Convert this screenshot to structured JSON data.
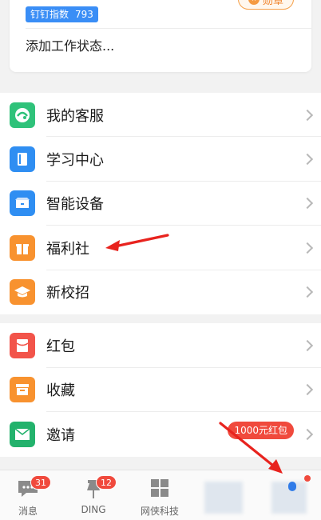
{
  "profile": {
    "index_label": "钉钉指数",
    "index_value": "793",
    "medal_label": "勋章",
    "status_placeholder": "添加工作状态..."
  },
  "menu_group_1": [
    {
      "label": "我的客服",
      "icon": "customer-service-icon",
      "color": "#2fc27a"
    },
    {
      "label": "学习中心",
      "icon": "book-icon",
      "color": "#2f8ef2"
    },
    {
      "label": "智能设备",
      "icon": "device-icon",
      "color": "#2f8ef2"
    },
    {
      "label": "福利社",
      "icon": "gift-icon",
      "color": "#f8922f"
    },
    {
      "label": "新校招",
      "icon": "graduation-cap-icon",
      "color": "#f8922f"
    }
  ],
  "menu_group_2": [
    {
      "label": "红包",
      "icon": "red-packet-icon",
      "color": "#f2544a"
    },
    {
      "label": "收藏",
      "icon": "favorites-box-icon",
      "color": "#f8922f"
    },
    {
      "label": "邀请",
      "icon": "mail-icon",
      "color": "#23b26c",
      "tag": "1000元红包"
    }
  ],
  "tabbar": [
    {
      "label": "消息",
      "badge": "31",
      "icon": "chat-icon"
    },
    {
      "label": "DING",
      "badge": "12",
      "icon": "pin-icon"
    },
    {
      "label": "网侠科技",
      "icon": "grid-icon"
    }
  ],
  "colors": {
    "accent_blue": "#3a8ef6",
    "badge_red": "#f04a3d",
    "medal_orange": "#f0852e",
    "annotation_red": "#e8231e"
  }
}
